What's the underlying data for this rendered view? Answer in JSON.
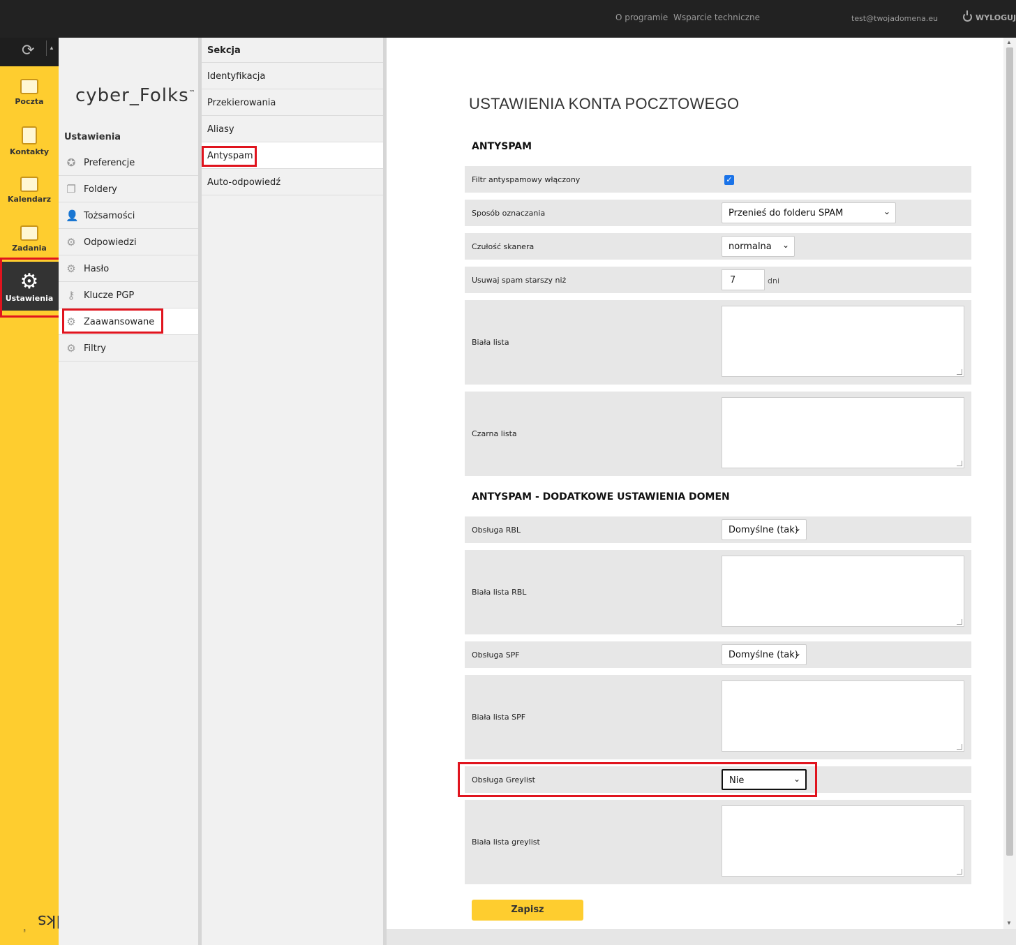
{
  "header": {
    "about": "O programie",
    "support": "Wsparcie techniczne",
    "user": "test@twojadomena.eu",
    "logout": "WYLOGUJ"
  },
  "apps": [
    {
      "label": "Poczta",
      "icon": "mail-icon"
    },
    {
      "label": "Kontakty",
      "icon": "contacts-icon"
    },
    {
      "label": "Kalendarz",
      "icon": "calendar-icon"
    },
    {
      "label": "Zadania",
      "icon": "tasks-icon"
    },
    {
      "label": "Ustawienia",
      "icon": "settings-icon",
      "active": true
    }
  ],
  "brand": {
    "name": "cyber_Folks",
    "tm": "™"
  },
  "settings_nav": {
    "title": "Ustawienia",
    "items": [
      {
        "label": "Preferencje",
        "icon": "star-icon"
      },
      {
        "label": "Foldery",
        "icon": "folder-icon"
      },
      {
        "label": "Tożsamości",
        "icon": "person-icon"
      },
      {
        "label": "Odpowiedzi",
        "icon": "gear-icon"
      },
      {
        "label": "Hasło",
        "icon": "gear-icon"
      },
      {
        "label": "Klucze PGP",
        "icon": "key-icon"
      },
      {
        "label": "Zaawansowane",
        "icon": "gear-icon",
        "selected": true
      },
      {
        "label": "Filtry",
        "icon": "gear-icon"
      }
    ]
  },
  "section_nav": {
    "title": "Sekcja",
    "items": [
      {
        "label": "Identyfikacja"
      },
      {
        "label": "Przekierowania"
      },
      {
        "label": "Aliasy"
      },
      {
        "label": "Antyspam",
        "selected": true
      },
      {
        "label": "Auto-odpowiedź"
      }
    ]
  },
  "page": {
    "title": "USTAWIENIA KONTA POCZTOWEGO",
    "section1": "ANTYSPAM",
    "section2": "ANTYSPAM - DODATKOWE USTAWIENIA DOMEN",
    "fields": {
      "filter_enabled": {
        "label": "Filtr antyspamowy włączony",
        "checked": true
      },
      "marking": {
        "label": "Sposób oznaczania",
        "value": "Przenieś do folderu SPAM"
      },
      "sensitivity": {
        "label": "Czułość skanera",
        "value": "normalna"
      },
      "delete_older": {
        "label": "Usuwaj spam starszy niż",
        "value": "7",
        "unit": "dni"
      },
      "whitelist": {
        "label": "Biała lista"
      },
      "blacklist": {
        "label": "Czarna lista"
      },
      "rbl": {
        "label": "Obsługa RBL",
        "value": "Domyślne (tak)"
      },
      "rbl_whitelist": {
        "label": "Biała lista RBL"
      },
      "spf": {
        "label": "Obsługa SPF",
        "value": "Domyślne (tak)"
      },
      "spf_whitelist": {
        "label": "Biała lista SPF"
      },
      "greylist": {
        "label": "Obsługa Greylist",
        "value": "Nie"
      },
      "greylist_whitelist": {
        "label": "Biała lista greylist"
      }
    },
    "save": "Zapisz"
  },
  "colors": {
    "accent": "#fecd2f",
    "highlight": "#e0141e",
    "dark": "#222222"
  }
}
